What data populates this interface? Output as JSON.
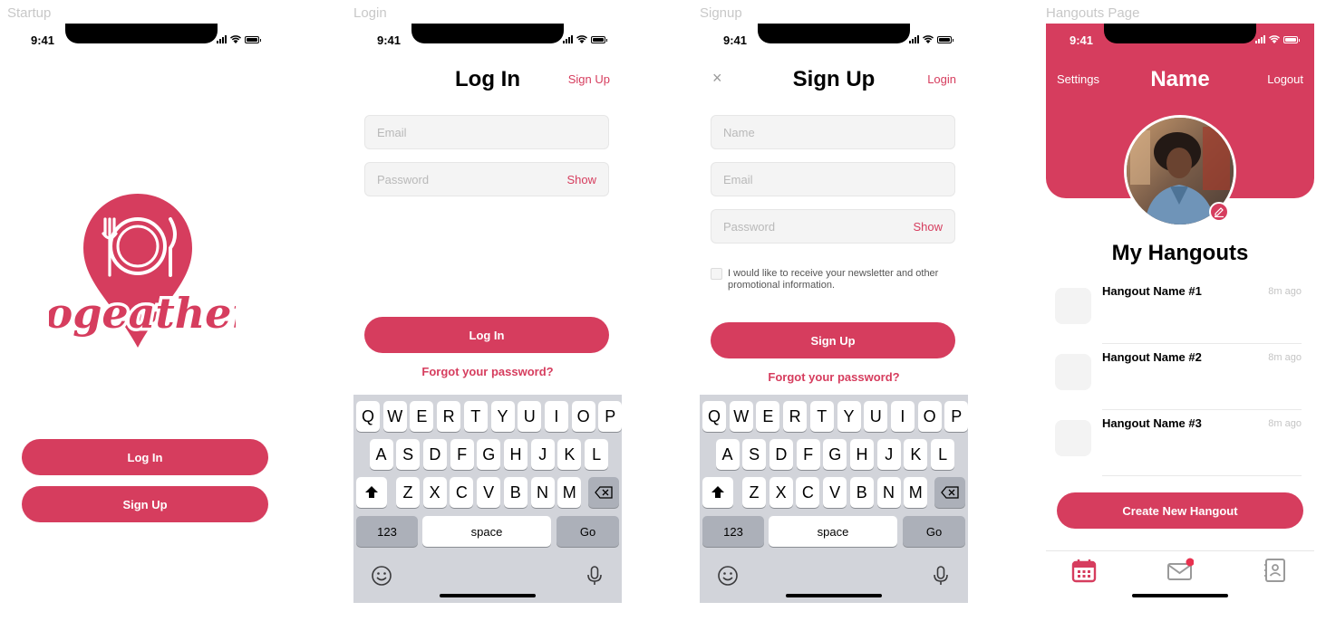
{
  "labels": {
    "startup": "Startup",
    "login": "Login",
    "signup": "Signup",
    "hangouts": "Hangouts Page"
  },
  "status_time": "9:41",
  "colors": {
    "brand": "#d63d5e",
    "keyboard": "#d2d4da"
  },
  "startup": {
    "logo_text": "togeather",
    "login_button": "Log In",
    "signup_button": "Sign Up"
  },
  "login": {
    "title": "Log In",
    "top_link": "Sign Up",
    "email_placeholder": "Email",
    "password_placeholder": "Password",
    "show": "Show",
    "submit": "Log In",
    "forgot": "Forgot your password?"
  },
  "signup": {
    "title": "Sign Up",
    "top_link": "Login",
    "close": "×",
    "name_placeholder": "Name",
    "email_placeholder": "Email",
    "password_placeholder": "Password",
    "show": "Show",
    "newsletter": "I would like to receive your newsletter and other promotional information.",
    "submit": "Sign Up",
    "forgot": "Forgot your password?"
  },
  "keyboard": {
    "row1": [
      "Q",
      "W",
      "E",
      "R",
      "T",
      "Y",
      "U",
      "I",
      "O",
      "P"
    ],
    "row2": [
      "A",
      "S",
      "D",
      "F",
      "G",
      "H",
      "J",
      "K",
      "L"
    ],
    "row3": [
      "Z",
      "X",
      "C",
      "V",
      "B",
      "N",
      "M"
    ],
    "numbers": "123",
    "space": "space",
    "go": "Go",
    "shift_icon": "shift-icon",
    "delete_icon": "backspace-icon",
    "emoji_icon": "emoji-icon",
    "mic_icon": "microphone-icon"
  },
  "hangouts": {
    "settings": "Settings",
    "name": "Name",
    "logout": "Logout",
    "section_title": "My Hangouts",
    "items": [
      {
        "name": "Hangout Name #1",
        "time": "8m ago"
      },
      {
        "name": "Hangout Name #2",
        "time": "8m ago"
      },
      {
        "name": "Hangout Name #3",
        "time": "8m ago"
      }
    ],
    "create_button": "Create New Hangout",
    "tabs": [
      "calendar-icon",
      "mail-icon",
      "contacts-icon"
    ]
  }
}
